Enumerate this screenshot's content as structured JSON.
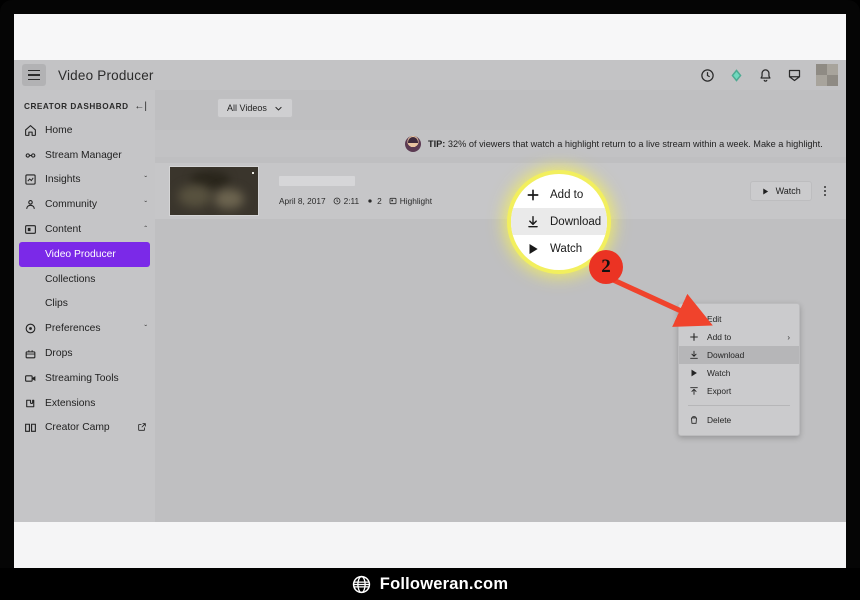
{
  "app": {
    "title": "Video Producer",
    "hamburger_icon": "hamburger-menu-icon",
    "topbar_icons": [
      "clock-icon",
      "bits-icon",
      "bell-icon",
      "whispers-icon"
    ],
    "avatar_icon": "user-avatar"
  },
  "sidebar": {
    "header": "CREATOR DASHBOARD",
    "collapse_icon": "collapse-sidebar-icon",
    "items": [
      {
        "label": "Home",
        "icon": "home-icon",
        "chevron": "",
        "sub": false
      },
      {
        "label": "Stream Manager",
        "icon": "sliders-icon",
        "chevron": "",
        "sub": false
      },
      {
        "label": "Insights",
        "icon": "insights-icon",
        "chevron": "ˇ",
        "sub": false
      },
      {
        "label": "Community",
        "icon": "community-icon",
        "chevron": "ˇ",
        "sub": false
      },
      {
        "label": "Content",
        "icon": "content-icon",
        "chevron": "ˆ",
        "sub": false
      },
      {
        "label": "Video Producer",
        "icon": "",
        "chevron": "",
        "sub": true,
        "active": true
      },
      {
        "label": "Collections",
        "icon": "",
        "chevron": "",
        "sub": true
      },
      {
        "label": "Clips",
        "icon": "",
        "chevron": "",
        "sub": true
      },
      {
        "label": "Preferences",
        "icon": "gear-icon",
        "chevron": "ˇ",
        "sub": false
      },
      {
        "label": "Drops",
        "icon": "drops-icon",
        "chevron": "",
        "sub": false
      },
      {
        "label": "Streaming Tools",
        "icon": "camera-icon",
        "chevron": "",
        "sub": false
      },
      {
        "label": "Extensions",
        "icon": "extensions-icon",
        "chevron": "",
        "sub": false
      },
      {
        "label": "Creator Camp",
        "icon": "book-icon",
        "external": "↗",
        "sub": false
      }
    ]
  },
  "main": {
    "filter": {
      "label": "All Videos",
      "chevron_icon": "chevron-down-icon"
    },
    "tip": {
      "avatar_icon": "tip-avatar-icon",
      "prefix": "TIP:",
      "text": " 32% of viewers that watch a highlight return to a live stream within a week. Make a highlight."
    },
    "video": {
      "thumbnail_icon": "video-thumbnail",
      "title_redacted": "",
      "date": "April 8, 2017",
      "duration_icon": "clock-icon",
      "duration": "2:11",
      "views_icon": "eye-icon",
      "views": "2",
      "type_icon": "highlight-icon",
      "type": "Highlight",
      "watch_label": "Watch",
      "watch_icon": "play-icon",
      "kebab_icon": "more-options-icon"
    }
  },
  "context_menu": {
    "items": [
      {
        "label": "Edit",
        "icon": "pencil-icon",
        "highlighted": false
      },
      {
        "label": "Add to",
        "icon": "plus-icon",
        "arrow": "›",
        "highlighted": false
      },
      {
        "label": "Download",
        "icon": "download-icon",
        "highlighted": true
      },
      {
        "label": "Watch",
        "icon": "play-icon",
        "highlighted": false
      },
      {
        "label": "Export",
        "icon": "export-icon",
        "highlighted": false
      },
      {
        "separator": true
      },
      {
        "label": "Delete",
        "icon": "trash-icon",
        "highlighted": false
      }
    ]
  },
  "callout": {
    "magnifier_items": [
      {
        "label": "Add to",
        "icon": "plus-icon",
        "glyph": "＋",
        "highlighted": false
      },
      {
        "label": "Download",
        "icon": "download-icon",
        "glyph": "⬇",
        "highlighted": true
      },
      {
        "label": "Watch",
        "icon": "play-icon",
        "glyph": "▶",
        "highlighted": false
      }
    ],
    "step_number": "2",
    "step_color": "#eb3323",
    "highlight_color": "#f2ef5e"
  },
  "footer": {
    "globe_icon": "globe-icon",
    "brand": "Followeran.com"
  }
}
